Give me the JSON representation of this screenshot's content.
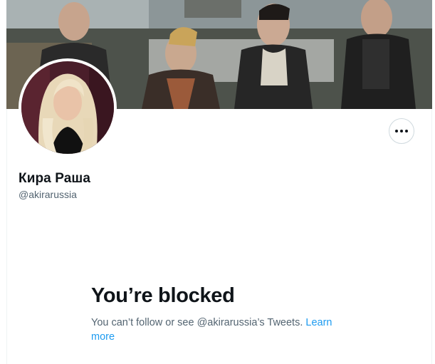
{
  "profile": {
    "display_name": "Кира Раша",
    "handle": "@akirarussia"
  },
  "actions": {
    "more_icon": "ellipsis-horizontal-icon"
  },
  "blocked": {
    "title": "You’re blocked",
    "message": "You can’t follow or see @akirarussia’s Tweets.",
    "learn_more": "Learn more"
  },
  "colors": {
    "text_primary": "#0f1419",
    "text_secondary": "#536471",
    "link": "#1d9bf0",
    "border": "#cfd9de"
  }
}
